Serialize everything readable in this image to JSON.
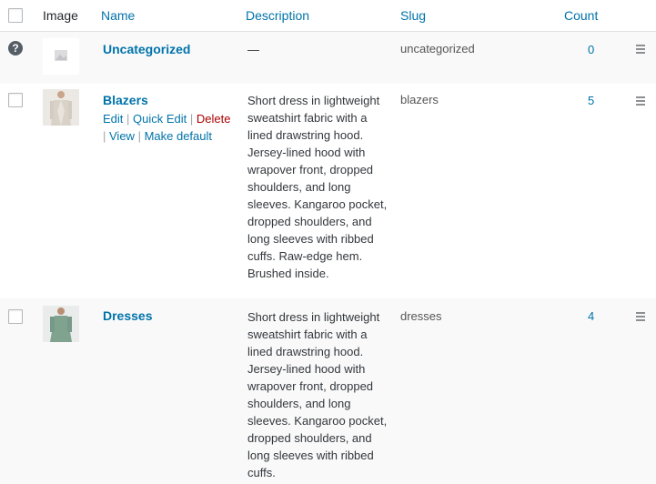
{
  "columns": {
    "image": "Image",
    "name": "Name",
    "description": "Description",
    "slug": "Slug",
    "count": "Count"
  },
  "rows": [
    {
      "name": "Uncategorized",
      "description": "—",
      "slug": "uncategorized",
      "count": "0"
    },
    {
      "name": "Blazers",
      "actions": {
        "edit": "Edit",
        "quick_edit": "Quick Edit",
        "delete": "Delete",
        "view": "View",
        "make_default": "Make default"
      },
      "description": "Short dress in lightweight sweatshirt fabric with a lined drawstring hood. Jersey-lined hood with wrapover front, dropped shoulders, and long sleeves. Kangaroo pocket, dropped shoulders, and long sleeves with ribbed cuffs. Raw-edge hem. Brushed inside.",
      "slug": "blazers",
      "count": "5"
    },
    {
      "name": "Dresses",
      "description": "Short dress in lightweight sweatshirt fabric with a lined drawstring hood. Jersey-lined hood with wrapover front, dropped shoulders, and long sleeves. Kangaroo pocket, dropped shoulders, and long sleeves with ribbed cuffs.",
      "slug": "dresses",
      "count": "4"
    }
  ]
}
